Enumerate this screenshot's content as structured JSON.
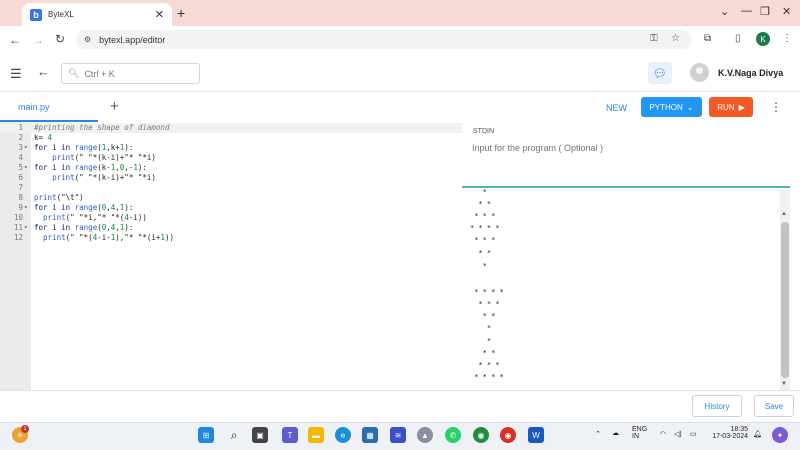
{
  "browser": {
    "tab_title": "ByteXL",
    "tab_favicon": "b",
    "url": "bytexl.app/editor",
    "profile_initial": "K"
  },
  "header": {
    "search_placeholder": "Ctrl + K",
    "user_name": "K.V.Naga Divya"
  },
  "toolbar": {
    "file_tab": "main.py",
    "new_label": "NEW",
    "language_label": "PYTHON",
    "run_label": "RUN"
  },
  "editor": {
    "lines": [
      {
        "n": "1",
        "fold": "",
        "code": "#printing the shape of diamond"
      },
      {
        "n": "2",
        "fold": "",
        "code": "k= 4"
      },
      {
        "n": "3",
        "fold": "▾",
        "code": "for i in range(1,k+1):"
      },
      {
        "n": "4",
        "fold": "",
        "code": "    print(\" \"*(k-i)+\"* \"*i)"
      },
      {
        "n": "5",
        "fold": "▾",
        "code": "for i in range(k-1,0,-1):"
      },
      {
        "n": "6",
        "fold": "",
        "code": "    print(\" \"*(k-i)+\"* \"*i)"
      },
      {
        "n": "7",
        "fold": "",
        "code": ""
      },
      {
        "n": "8",
        "fold": "",
        "code": "print(\"\\t\")"
      },
      {
        "n": "9",
        "fold": "▾",
        "code": "for i in range(0,4,1):"
      },
      {
        "n": "10",
        "fold": "",
        "code": "  print(\" \"*i,\"* \"*(4-i))"
      },
      {
        "n": "11",
        "fold": "▾",
        "code": "for i in range(0,4,1):"
      },
      {
        "n": "12",
        "fold": "",
        "code": "  print(\" \"*(4-i-1),\"* \"*(i+1))"
      }
    ]
  },
  "stdin": {
    "label": "STDIN",
    "placeholder": "Input for the program ( Optional )"
  },
  "output": {
    "lines": [
      "   *",
      "  * *",
      " * * *",
      "* * * *",
      " * * *",
      "  * *",
      "   *",
      "",
      " * * * *",
      "  * * *",
      "   * *",
      "    *",
      "    *",
      "   * *",
      "  * * *",
      " * * * *"
    ]
  },
  "footer": {
    "history_label": "History",
    "save_label": "Save"
  },
  "taskbar": {
    "notification_count": "1",
    "language": "ENG",
    "region": "IN",
    "time": "18:35",
    "date": "17-03-2024"
  }
}
